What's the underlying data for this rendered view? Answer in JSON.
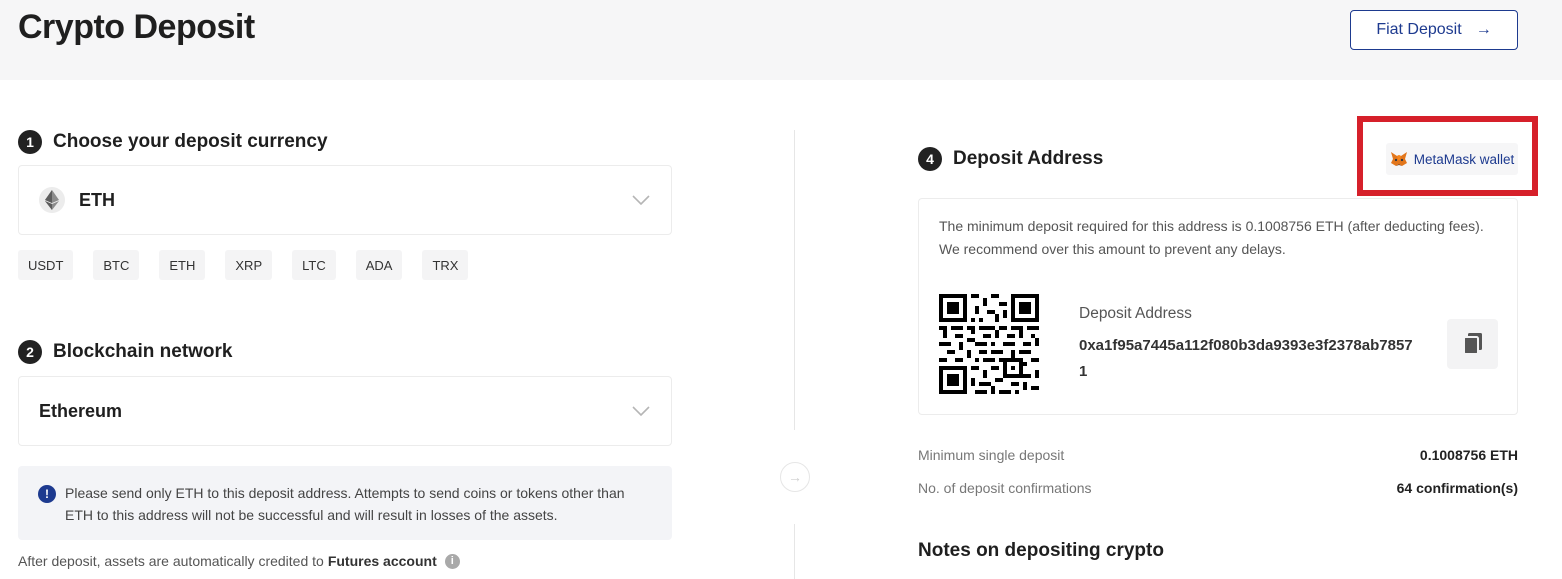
{
  "page": {
    "title": "Crypto Deposit"
  },
  "header": {
    "fiat_button_label": "Fiat Deposit",
    "fiat_button_arrow": "→"
  },
  "step1": {
    "number": "1",
    "label": "Choose your deposit currency",
    "selected_currency": "ETH"
  },
  "currency_chips": [
    "USDT",
    "BTC",
    "ETH",
    "XRP",
    "LTC",
    "ADA",
    "TRX"
  ],
  "step2": {
    "number": "2",
    "label": "Blockchain network",
    "selected_network": "Ethereum"
  },
  "notice": {
    "icon": "!",
    "text": "Please send only ETH to this deposit address. Attempts to send coins or tokens other than ETH to this address will not be successful and will result in losses of the assets."
  },
  "after_deposit": {
    "text": "After deposit, assets are automatically credited to",
    "account": "Futures account",
    "info_icon": "i"
  },
  "step4": {
    "number": "4",
    "label": "Deposit Address",
    "wallet_button_label": "MetaMask wallet",
    "min_note": "The minimum deposit required for this address is 0.1008756 ETH (after deducting fees). We recommend over this amount to prevent any delays.",
    "address_label": "Deposit Address",
    "address_value": "0xa1f95a7445a112f080b3da9393e3f2378ab78571"
  },
  "details": {
    "min_single_deposit_label": "Minimum single deposit",
    "min_single_deposit_value": "0.1008756 ETH",
    "confirmations_label": "No. of deposit confirmations",
    "confirmations_value": "64 confirmation(s)"
  },
  "notes": {
    "title": "Notes on depositing crypto"
  },
  "colors": {
    "accent": "#1d3a8f",
    "highlight": "#d6202a",
    "step_badge": "#222222"
  }
}
